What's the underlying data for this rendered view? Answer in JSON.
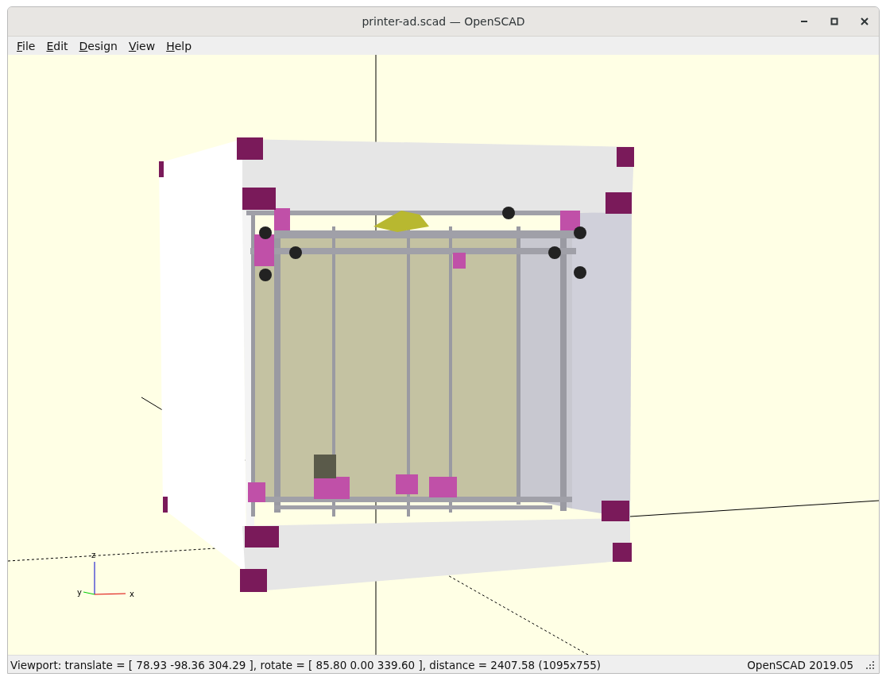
{
  "window": {
    "title": "printer-ad.scad — OpenSCAD"
  },
  "menu": [
    "File",
    "Edit",
    "Design",
    "View",
    "Help"
  ],
  "viewport": {
    "axis_labels": {
      "x": "x",
      "y": "y",
      "z": "z"
    }
  },
  "status_bar": {
    "viewport_info": "Viewport: translate = [ 78.93 -98.36 304.29 ], rotate = [ 85.80 0.00 339.60 ], distance = 2407.58 (1095x755)",
    "version": "OpenSCAD 2019.05"
  }
}
